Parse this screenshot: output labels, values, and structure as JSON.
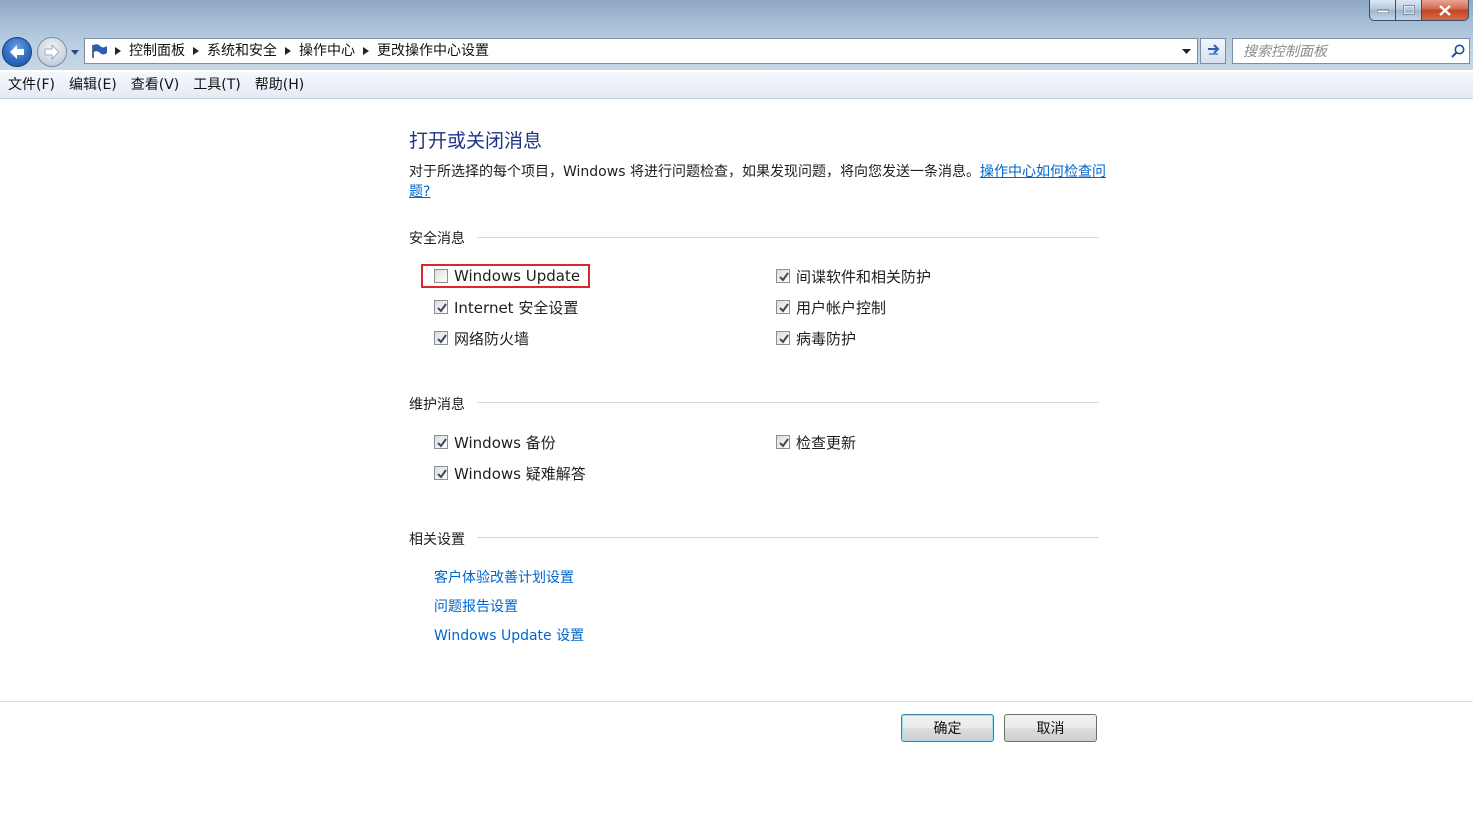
{
  "breadcrumb": [
    "控制面板",
    "系统和安全",
    "操作中心",
    "更改操作中心设置"
  ],
  "search": {
    "placeholder": "搜索控制面板"
  },
  "menu": [
    "文件(F)",
    "编辑(E)",
    "查看(V)",
    "工具(T)",
    "帮助(H)"
  ],
  "page": {
    "title": "打开或关闭消息",
    "description": "对于所选择的每个项目，Windows 将进行问题检查，如果发现问题，将向您发送一条消息。",
    "help_link": "操作中心如何检查问题?"
  },
  "sections": {
    "security": {
      "heading": "安全消息",
      "items": [
        {
          "label": "Windows Update",
          "checked": false
        },
        {
          "label": "间谍软件和相关防护",
          "checked": true
        },
        {
          "label": "Internet 安全设置",
          "checked": true
        },
        {
          "label": "用户帐户控制",
          "checked": true
        },
        {
          "label": "网络防火墙",
          "checked": true
        },
        {
          "label": "病毒防护",
          "checked": true
        }
      ]
    },
    "maintenance": {
      "heading": "维护消息",
      "items": [
        {
          "label": "Windows 备份",
          "checked": true
        },
        {
          "label": "检查更新",
          "checked": true
        },
        {
          "label": "Windows 疑难解答",
          "checked": true
        }
      ]
    },
    "related": {
      "heading": "相关设置",
      "links": [
        "客户体验改善计划设置",
        "问题报告设置",
        "Windows Update 设置"
      ]
    }
  },
  "buttons": {
    "ok": "确定",
    "cancel": "取消"
  },
  "colors": {
    "link": "#0066cc",
    "title": "#1e3287",
    "highlight": "#e0242b"
  }
}
